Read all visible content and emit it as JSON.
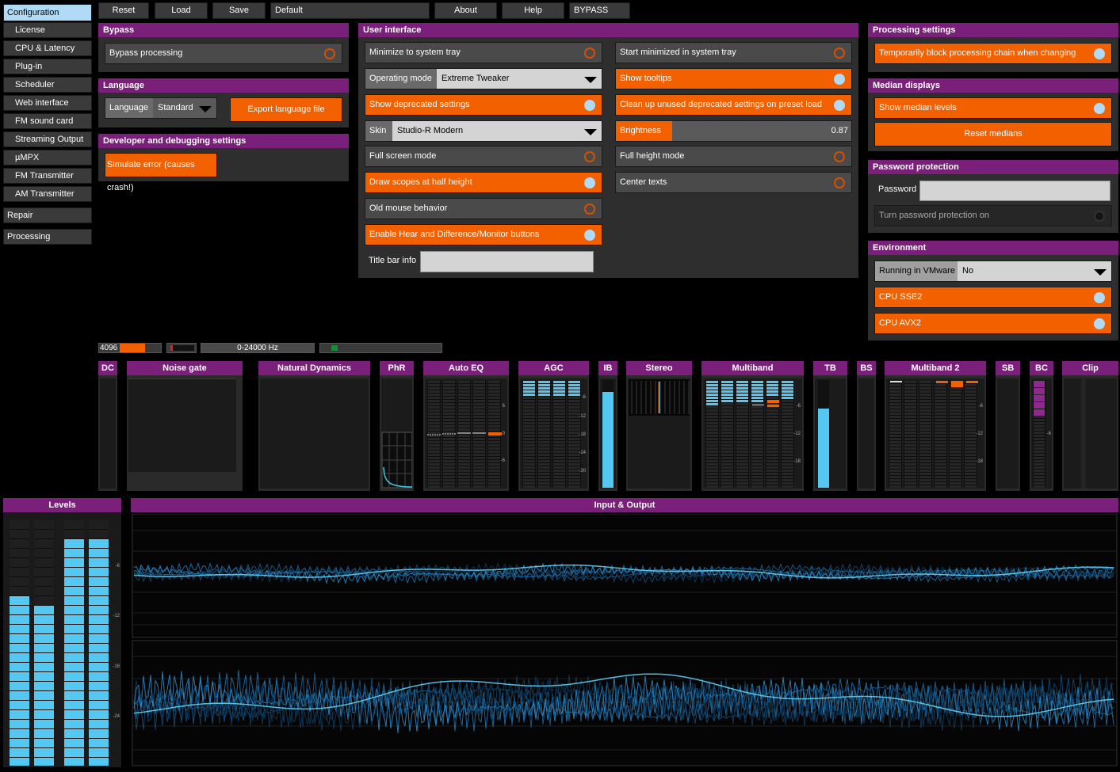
{
  "sidebar": {
    "items": [
      {
        "label": "Configuration",
        "active": true
      },
      {
        "label": "License"
      },
      {
        "label": "CPU & Latency"
      },
      {
        "label": "Plug-in"
      },
      {
        "label": "Scheduler"
      },
      {
        "label": "Web interface"
      },
      {
        "label": "FM sound card"
      },
      {
        "label": "Streaming Output"
      },
      {
        "label": "µMPX"
      },
      {
        "label": "FM Transmitter"
      },
      {
        "label": "AM Transmitter"
      },
      {
        "label": "Repair"
      },
      {
        "label": "Processing"
      }
    ]
  },
  "toolbar": {
    "reset": "Reset",
    "load": "Load",
    "save": "Save",
    "preset": "Default",
    "about": "About",
    "help": "Help",
    "bypass": "BYPASS"
  },
  "bypass_panel": {
    "title": "Bypass",
    "bypass_processing": "Bypass processing"
  },
  "language_panel": {
    "title": "Language",
    "label": "Language",
    "value": "Standard",
    "export": "Export language file"
  },
  "dev_panel": {
    "title": "Developer and debugging settings",
    "simulate_error": "Simulate error (causes crash!)"
  },
  "ui_panel": {
    "title": "User interface",
    "minimize_tray": "Minimize to system tray",
    "start_minimized": "Start minimized in system tray",
    "operating_mode_label": "Operating mode",
    "operating_mode_value": "Extreme Tweaker",
    "show_tooltips": "Show tooltips",
    "show_deprecated": "Show deprecated settings",
    "cleanup_deprecated": "Clean up unused deprecated settings on preset load",
    "skin_label": "Skin",
    "skin_value": "Studio-R Modern",
    "brightness_label": "Brightness",
    "brightness_value": "0.87",
    "brightness_level": 0.24,
    "full_screen": "Full screen mode",
    "full_height": "Full height mode",
    "half_height": "Draw scopes at half height",
    "center_texts": "Center texts",
    "old_mouse": "Old mouse behavior",
    "hear_diff": "Enable Hear and Difference/Monitor buttons",
    "title_bar_label": "Title bar info",
    "title_bar_value": ""
  },
  "processing_settings": {
    "title": "Processing settings",
    "block_chain": "Temporarily block processing chain when changing"
  },
  "median_displays": {
    "title": "Median displays",
    "show_median": "Show median levels",
    "reset_medians": "Reset medians"
  },
  "password_panel": {
    "title": "Password protection",
    "password_label": "Password",
    "password_value": "",
    "turn_on": "Turn password protection on"
  },
  "environment_panel": {
    "title": "Environment",
    "vmware_label": "Running in VMware",
    "vmware_value": "No",
    "sse2": "CPU SSE2",
    "avx2": "CPU AVX2"
  },
  "status": {
    "buffer": "4096",
    "freq": "0-24000 Hz"
  },
  "modules": [
    {
      "name": "DC"
    },
    {
      "name": "Noise gate"
    },
    {
      "name": "Natural Dynamics"
    },
    {
      "name": "PhR"
    },
    {
      "name": "Auto EQ"
    },
    {
      "name": "AGC"
    },
    {
      "name": "IB"
    },
    {
      "name": "Stereo"
    },
    {
      "name": "Multiband"
    },
    {
      "name": "TB"
    },
    {
      "name": "BS"
    },
    {
      "name": "Multiband 2"
    },
    {
      "name": "SB"
    },
    {
      "name": "BC"
    },
    {
      "name": "Clip"
    }
  ],
  "scale_labels": {
    "autoeq": [
      "6",
      "0",
      "-6"
    ],
    "agc": [
      "-6",
      "-12",
      "-18",
      "-24",
      "-30"
    ],
    "mb": [
      "-6",
      "-12",
      "-18"
    ],
    "bc": [
      "-6"
    ],
    "levels": [
      "-6",
      "-12",
      "-18",
      "-24"
    ]
  },
  "levels": {
    "title": "Levels",
    "bars": [
      0.69,
      0.68,
      0.95,
      0.93
    ]
  },
  "io": {
    "title": "Input & Output"
  },
  "colors": {
    "accent": "#f26000",
    "header": "#7a1f7a",
    "meter": "#54c8f0",
    "toggle_on": "#b0daf5"
  }
}
